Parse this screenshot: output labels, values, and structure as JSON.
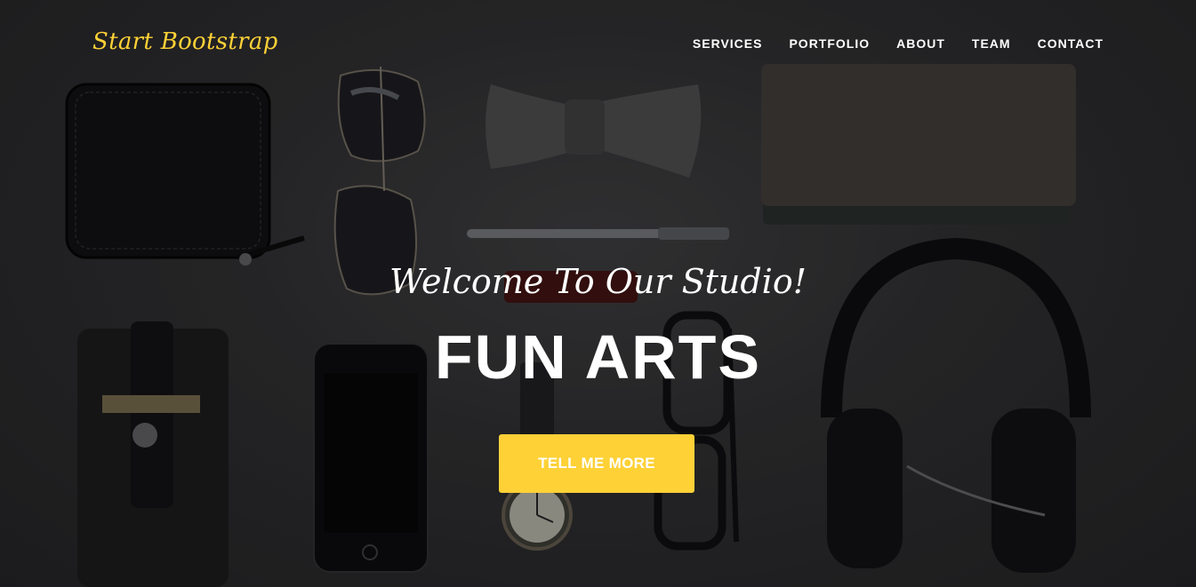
{
  "navbar": {
    "brand": "Start Bootstrap",
    "links": [
      "SERVICES",
      "PORTFOLIO",
      "ABOUT",
      "TEAM",
      "CONTACT"
    ]
  },
  "intro": {
    "lead": "Welcome To Our Studio!",
    "heading": "FUN ARTS",
    "button": "TELL ME MORE"
  },
  "colors": {
    "accent": "#fed136",
    "background": "#2c2c2e",
    "text": "#ffffff"
  },
  "background_image": {
    "objects": [
      "wallet-icon",
      "sunglasses-icon",
      "bow-tie-icon",
      "pen-icon",
      "notebook-icon",
      "phone-case-icon",
      "smartphone-icon",
      "wristwatch-icon",
      "eyeglasses-icon",
      "headphones-icon"
    ]
  }
}
